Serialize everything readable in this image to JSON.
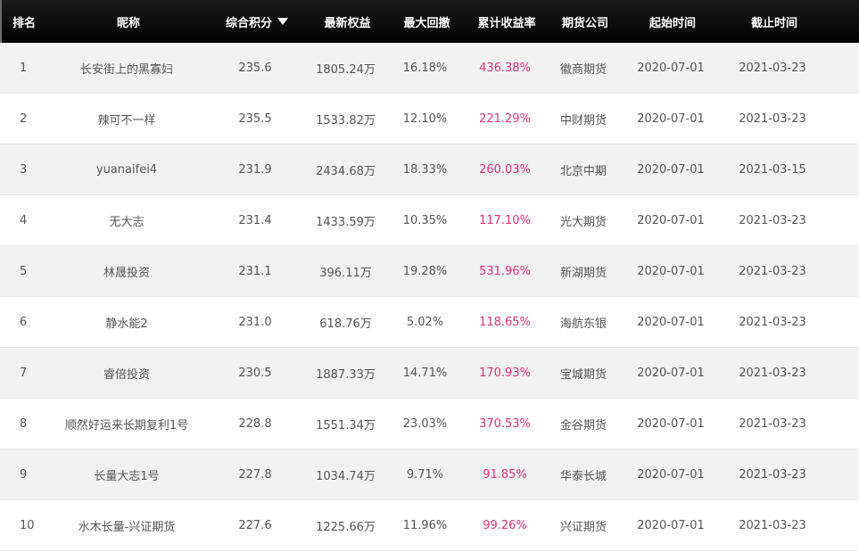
{
  "headers": {
    "rank": "排名",
    "nickname": "昵称",
    "score": "综合积分",
    "equity": "最新权益",
    "max_drawdown": "最大回撤",
    "cumulative_return": "累计收益率",
    "broker": "期货公司",
    "start_date": "起始时间",
    "end_date": "截止时间"
  },
  "sort_icon": "sort-desc-icon",
  "colors": {
    "header_bg": "#000000",
    "row_alt": "#f2f2f2",
    "return_text": "#e0317a"
  },
  "rows": [
    {
      "rank": "1",
      "nickname": "长安街上的黑寡妇",
      "score": "235.6",
      "equity": "1805.24万",
      "max_drawdown": "16.18%",
      "cumulative_return": "436.38%",
      "broker": "徽商期货",
      "start_date": "2020-07-01",
      "end_date": "2021-03-23"
    },
    {
      "rank": "2",
      "nickname": "辣可不一样",
      "score": "235.5",
      "equity": "1533.82万",
      "max_drawdown": "12.10%",
      "cumulative_return": "221.29%",
      "broker": "中财期货",
      "start_date": "2020-07-01",
      "end_date": "2021-03-23"
    },
    {
      "rank": "3",
      "nickname": "yuanaifei4",
      "score": "231.9",
      "equity": "2434.68万",
      "max_drawdown": "18.33%",
      "cumulative_return": "260.03%",
      "broker": "北京中期",
      "start_date": "2020-07-01",
      "end_date": "2021-03-15"
    },
    {
      "rank": "4",
      "nickname": "无大志",
      "score": "231.4",
      "equity": "1433.59万",
      "max_drawdown": "10.35%",
      "cumulative_return": "117.10%",
      "broker": "光大期货",
      "start_date": "2020-07-01",
      "end_date": "2021-03-23"
    },
    {
      "rank": "5",
      "nickname": "林晟投资",
      "score": "231.1",
      "equity": "396.11万",
      "max_drawdown": "19.28%",
      "cumulative_return": "531.96%",
      "broker": "新湖期货",
      "start_date": "2020-07-01",
      "end_date": "2021-03-23"
    },
    {
      "rank": "6",
      "nickname": "静水能2",
      "score": "231.0",
      "equity": "618.76万",
      "max_drawdown": "5.02%",
      "cumulative_return": "118.65%",
      "broker": "海航东银",
      "start_date": "2020-07-01",
      "end_date": "2021-03-23"
    },
    {
      "rank": "7",
      "nickname": "睿倍投资",
      "score": "230.5",
      "equity": "1887.33万",
      "max_drawdown": "14.71%",
      "cumulative_return": "170.93%",
      "broker": "宝城期货",
      "start_date": "2020-07-01",
      "end_date": "2021-03-23"
    },
    {
      "rank": "8",
      "nickname": "顺然好运来长期复利1号",
      "score": "228.8",
      "equity": "1551.34万",
      "max_drawdown": "23.03%",
      "cumulative_return": "370.53%",
      "broker": "金谷期货",
      "start_date": "2020-07-01",
      "end_date": "2021-03-23"
    },
    {
      "rank": "9",
      "nickname": "长量大志1号",
      "score": "227.8",
      "equity": "1034.74万",
      "max_drawdown": "9.71%",
      "cumulative_return": "91.85%",
      "broker": "华泰长城",
      "start_date": "2020-07-01",
      "end_date": "2021-03-23"
    },
    {
      "rank": "10",
      "nickname": "水木长量-兴证期货",
      "score": "227.6",
      "equity": "1225.66万",
      "max_drawdown": "11.96%",
      "cumulative_return": "99.26%",
      "broker": "兴证期货",
      "start_date": "2020-07-01",
      "end_date": "2021-03-23"
    }
  ]
}
